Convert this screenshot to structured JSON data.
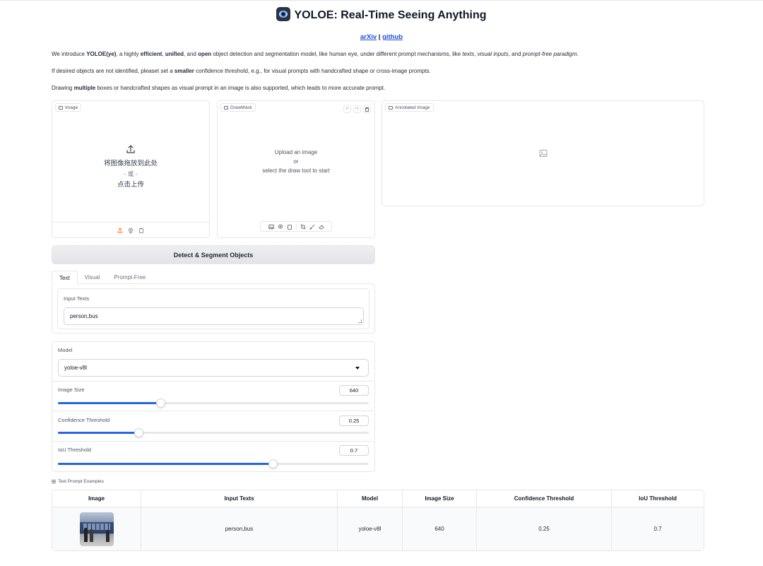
{
  "header": {
    "title": "YOLOE: Real-Time Seeing Anything",
    "link_arxiv": "arXiv",
    "link_separator": " | ",
    "link_github": "github"
  },
  "intro": {
    "p1": {
      "t1": "We introduce ",
      "b1": "YOLOE(ye)",
      "t2": ", a highly ",
      "b2": "efficient",
      "t3": ", ",
      "b3": "unified",
      "t4": ", and ",
      "b4": "open",
      "t5": " object detection and segmentation model, like human eye, under different prompt mechanisms, like ",
      "i1": "texts",
      "t6": ", ",
      "i2": "visual inputs",
      "t7": ", and ",
      "i3": "prompt-free paradigm",
      "t8": "."
    },
    "p2": {
      "t1": "If desired objects are not identified, pleaset set a ",
      "b1": "smaller",
      "t2": " confidence threshold, e.g., for visual prompts with handcrafted shape or cross-image prompts."
    },
    "p3": {
      "t1": "Drawing ",
      "b1": "multiple",
      "t2": " boxes or handcrafted shapes as visual prompt in an image is also supported, which leads to more accurate prompt."
    }
  },
  "image_panel": {
    "label": "Image",
    "drop_text": "将图像拖放到此处",
    "or_text": "- 或 -",
    "click_text": "点击上传"
  },
  "drawmask_panel": {
    "label": "DrawMask",
    "line1": "Upload an image",
    "line2": "or",
    "line3": "select the draw tool to start"
  },
  "annotated_panel": {
    "label": "Annotated Image"
  },
  "detect_button": "Detect & Segment Objects",
  "tabs": [
    "Text",
    "Visual",
    "Prompt-Free"
  ],
  "input_texts": {
    "label": "Input Texts",
    "value": "person,bus"
  },
  "settings": {
    "model_label": "Model",
    "model_value": "yoloe-v8l",
    "image_size": {
      "label": "Image Size",
      "value": "640",
      "fraction": 0.33
    },
    "confidence": {
      "label": "Confidence Threshold",
      "value": "0.25",
      "fraction": 0.26
    },
    "iou": {
      "label": "IoU Threshold",
      "value": "0.7",
      "fraction": 0.69
    }
  },
  "examples": {
    "label": "Text Prompt Examples",
    "headers": [
      "Image",
      "Input Texts",
      "Model",
      "Image Size",
      "Confidence Threshold",
      "IoU Threshold"
    ],
    "rows": [
      {
        "input_texts": "person,bus",
        "model": "yoloe-v8l",
        "image_size": "640",
        "confidence": "0.25",
        "iou": "0.7"
      }
    ]
  },
  "colors": {
    "accent": "#2563eb",
    "upload_accent": "#f97316",
    "link": "#1d4ed8"
  }
}
